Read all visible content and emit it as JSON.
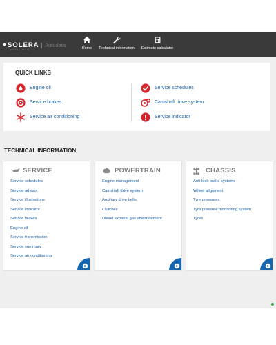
{
  "brand": {
    "logo_text": "SOLERA",
    "product_text": "Autodata",
    "tagline": "Autodata · Solera"
  },
  "nav": {
    "items": [
      {
        "label": "Home",
        "icon": "home-icon"
      },
      {
        "label": "Technical information",
        "icon": "wrench-icon"
      },
      {
        "label": "Estimate calculator",
        "icon": "calculator-icon"
      }
    ]
  },
  "quick_links": {
    "title": "QUICK LINKS",
    "left": [
      {
        "label": "Engine oil",
        "icon": "oil-drop-icon"
      },
      {
        "label": "Service brakes",
        "icon": "brake-disc-icon"
      },
      {
        "label": "Service air conditioning",
        "icon": "snowflake-icon"
      }
    ],
    "right": [
      {
        "label": "Service schedules",
        "icon": "check-circle-icon"
      },
      {
        "label": "Camshaft drive system",
        "icon": "belt-drive-icon"
      },
      {
        "label": "Service indicator",
        "icon": "warning-icon"
      }
    ]
  },
  "technical_information": {
    "title": "TECHNICAL INFORMATION",
    "cards": [
      {
        "title": "SERVICE",
        "icon": "oil-can-icon",
        "links": [
          "Service schedules",
          "Service advisor",
          "Service illustrations",
          "Service indicator",
          "Service brakes",
          "Engine oil",
          "Service transmission",
          "Service summary",
          "Service air conditioning"
        ]
      },
      {
        "title": "POWERTRAIN",
        "icon": "engine-icon",
        "links": [
          "Engine management",
          "Camshaft drive system",
          "Auxiliary drive belts",
          "Clutches",
          "Diesel exhaust gas aftertreatment"
        ]
      },
      {
        "title": "CHASSIS",
        "icon": "chassis-icon",
        "links": [
          "Anti-lock brake systems",
          "Wheel alignment",
          "Tyre pressures",
          "Tyre pressure monitoring system",
          "Tyres"
        ]
      }
    ]
  },
  "colors": {
    "topbar": "#3a3a3a",
    "accent_red": "#d9262c",
    "link_blue": "#1b5fa8",
    "arrow_blue": "#1466b0",
    "status_green": "#3aa845"
  }
}
